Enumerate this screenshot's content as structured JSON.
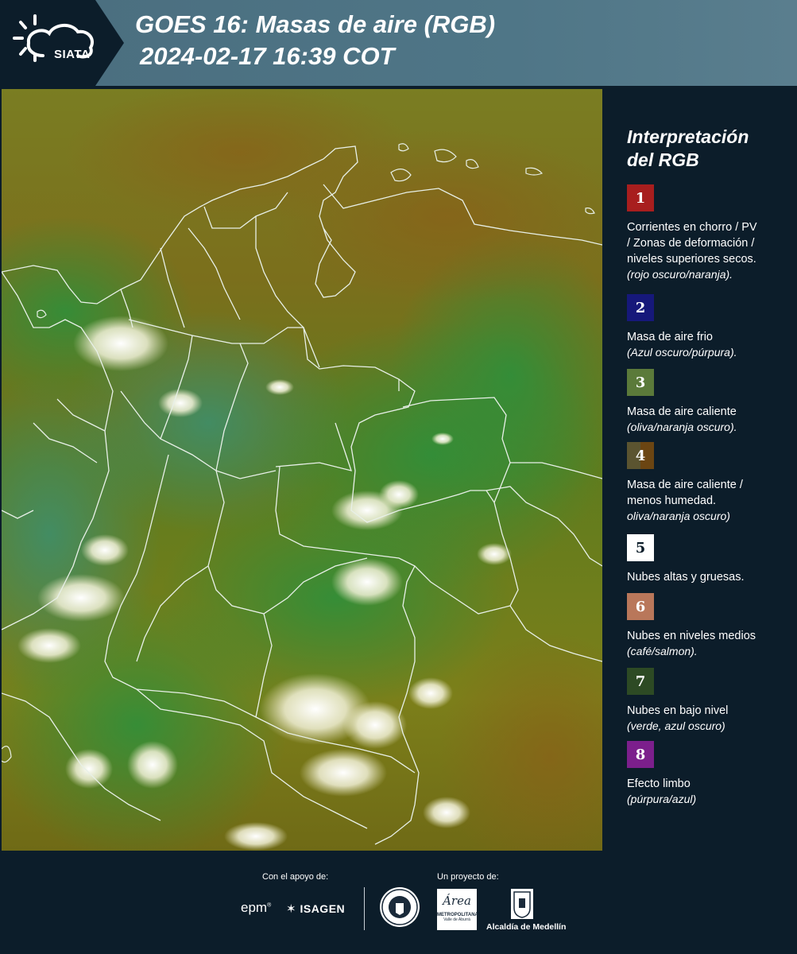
{
  "header": {
    "logo_text": "SIATA",
    "title": "GOES 16: Masas de aire (RGB)",
    "subtitle": "2024-02-17 16:39 COT"
  },
  "legend": {
    "title_line1": "Interpretación",
    "title_line2": "del RGB",
    "items": [
      {
        "number": "1",
        "color": "#a81e1e",
        "lines": [
          "Corrientes en chorro / PV",
          "/ Zonas de deformación /",
          "niveles superiores secos."
        ],
        "note": "(rojo oscuro/naranja)."
      },
      {
        "number": "2",
        "color": "#16187a",
        "lines": [
          "Masa de aire frio"
        ],
        "note": "(Azul oscuro/púrpura)."
      },
      {
        "number": "3",
        "color": "#5b7a3a",
        "lines": [
          "Masa de aire caliente"
        ],
        "note": "(oliva/naranja oscuro)."
      },
      {
        "number": "4",
        "color": "#5f5228",
        "lines": [
          "Masa de aire caliente /",
          "menos humedad."
        ],
        "note": "oliva/naranja oscuro)"
      },
      {
        "number": "5",
        "color": "#ffffff",
        "lines": [
          "Nubes altas y gruesas."
        ],
        "note": ""
      },
      {
        "number": "6",
        "color": "#b9775a",
        "lines": [
          "Nubes en niveles medios"
        ],
        "note": "(café/salmon)."
      },
      {
        "number": "7",
        "color": "#2d4a24",
        "lines": [
          "Nubes en bajo nivel"
        ],
        "note": "(verde, azul oscuro)"
      },
      {
        "number": "8",
        "color": "#7c1f8c",
        "lines": [
          "Efecto limbo"
        ],
        "note": "(púrpura/azul)"
      }
    ]
  },
  "footer": {
    "support_label": "Con el apoyo de:",
    "project_label": "Un proyecto de:",
    "sponsor_epm": "epm",
    "sponsor_isagen": "ISAGEN",
    "metro_name": "METROPOLITANA",
    "metro_sub": "Valle de Aburrá",
    "metro_script": "Área",
    "alcaldia": "Alcaldía de Medellín"
  }
}
